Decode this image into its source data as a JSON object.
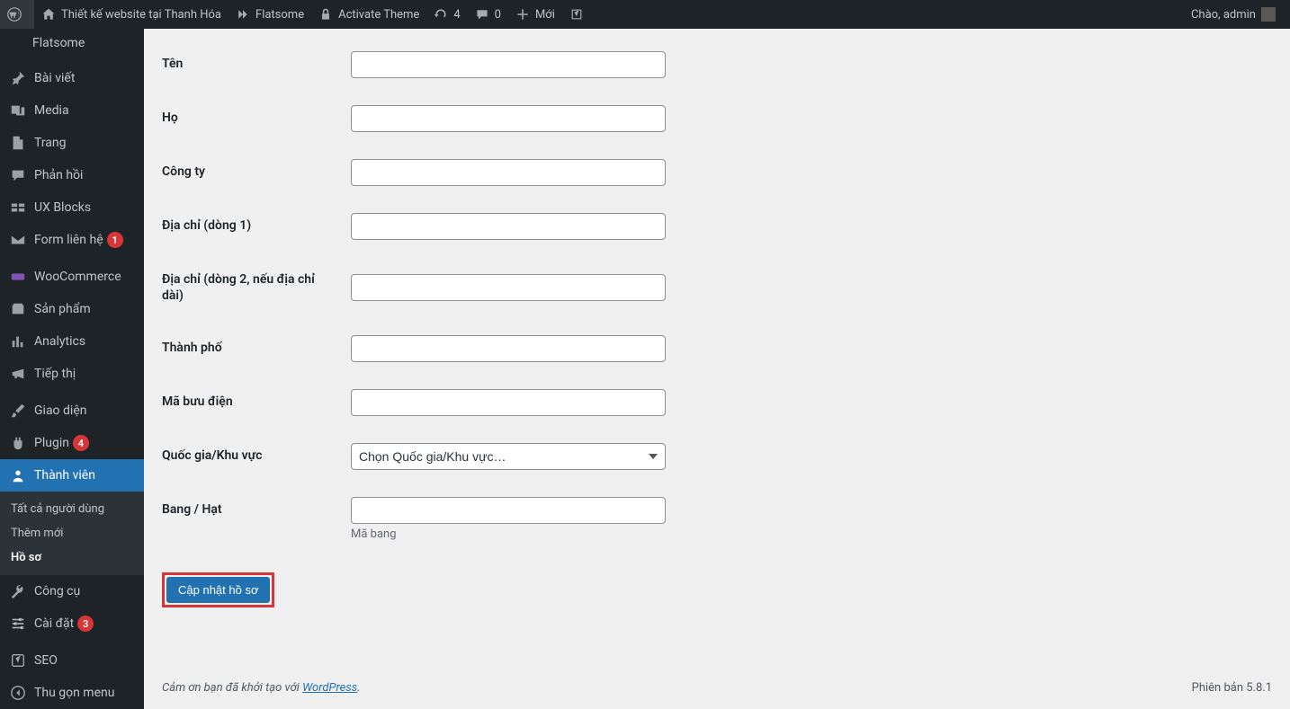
{
  "adminbar": {
    "site_name": "Thiết kế website tại Thanh Hóa",
    "theme_name": "Flatsome",
    "activate_theme": "Activate Theme",
    "updates_count": "4",
    "comments_count": "0",
    "new_label": "Mới",
    "greeting": "Chào, admin"
  },
  "sidebar": {
    "flatsome": "Flatsome",
    "items": [
      {
        "label": "Bài viết"
      },
      {
        "label": "Media"
      },
      {
        "label": "Trang"
      },
      {
        "label": "Phản hồi"
      },
      {
        "label": "UX Blocks"
      },
      {
        "label": "Form liên hệ",
        "badge": "1"
      },
      {
        "label": "WooCommerce"
      },
      {
        "label": "Sản phẩm"
      },
      {
        "label": "Analytics"
      },
      {
        "label": "Tiếp thị"
      },
      {
        "label": "Giao diện"
      },
      {
        "label": "Plugin",
        "badge": "4"
      },
      {
        "label": "Thành viên"
      },
      {
        "label": "Công cụ"
      },
      {
        "label": "Cài đặt",
        "badge": "3"
      },
      {
        "label": "SEO"
      },
      {
        "label": "Thu gọn menu"
      }
    ],
    "submenu": {
      "all_users": "Tất cả người dùng",
      "add_new": "Thêm mới",
      "profile": "Hồ sơ"
    }
  },
  "form": {
    "fields": {
      "first_name": {
        "label": "Tên",
        "value": ""
      },
      "last_name": {
        "label": "Họ",
        "value": ""
      },
      "company": {
        "label": "Công ty",
        "value": ""
      },
      "address1": {
        "label": "Địa chỉ (dòng 1)",
        "value": ""
      },
      "address2": {
        "label": "Địa chỉ (dòng 2, nếu địa chỉ dài)",
        "value": ""
      },
      "city": {
        "label": "Thành phố",
        "value": ""
      },
      "postcode": {
        "label": "Mã bưu điện",
        "value": ""
      },
      "country": {
        "label": "Quốc gia/Khu vực",
        "placeholder": "Chọn Quốc gia/Khu vực…"
      },
      "state": {
        "label": "Bang / Hạt",
        "value": "",
        "help": "Mã bang"
      }
    },
    "submit": "Cập nhật hồ sơ"
  },
  "footer": {
    "thanks_prefix": "Cảm ơn bạn đã khởi tạo với ",
    "wordpress": "WordPress",
    "thanks_suffix": ".",
    "version": "Phiên bản 5.8.1"
  }
}
